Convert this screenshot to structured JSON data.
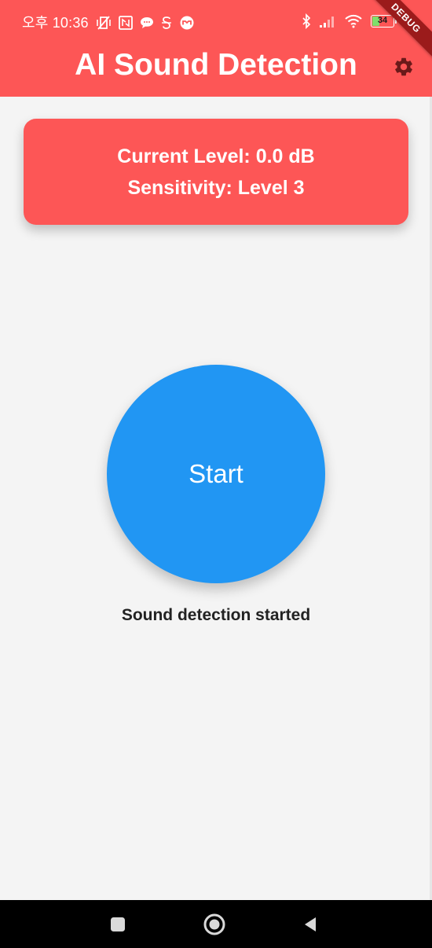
{
  "status_bar": {
    "time": "오후 10:36",
    "battery": "34",
    "battery_level": 0.34
  },
  "debug_banner": "DEBUG",
  "app_bar": {
    "title": "AI Sound Detection",
    "settings_icon": "gear-icon"
  },
  "info_card": {
    "current_level": "Current Level: 0.0 dB",
    "sensitivity": "Sensitivity: Level 3"
  },
  "main": {
    "start_label": "Start",
    "status_message": "Sound detection started"
  },
  "nav_bar": {
    "recents_icon": "square-icon",
    "home_icon": "circle-icon",
    "back_icon": "triangle-back-icon"
  },
  "colors": {
    "header": "#fd5656",
    "card": "#fd5656",
    "button": "#2196f3",
    "background": "#f4f4f4",
    "debug_banner": "#9b1b1b"
  }
}
